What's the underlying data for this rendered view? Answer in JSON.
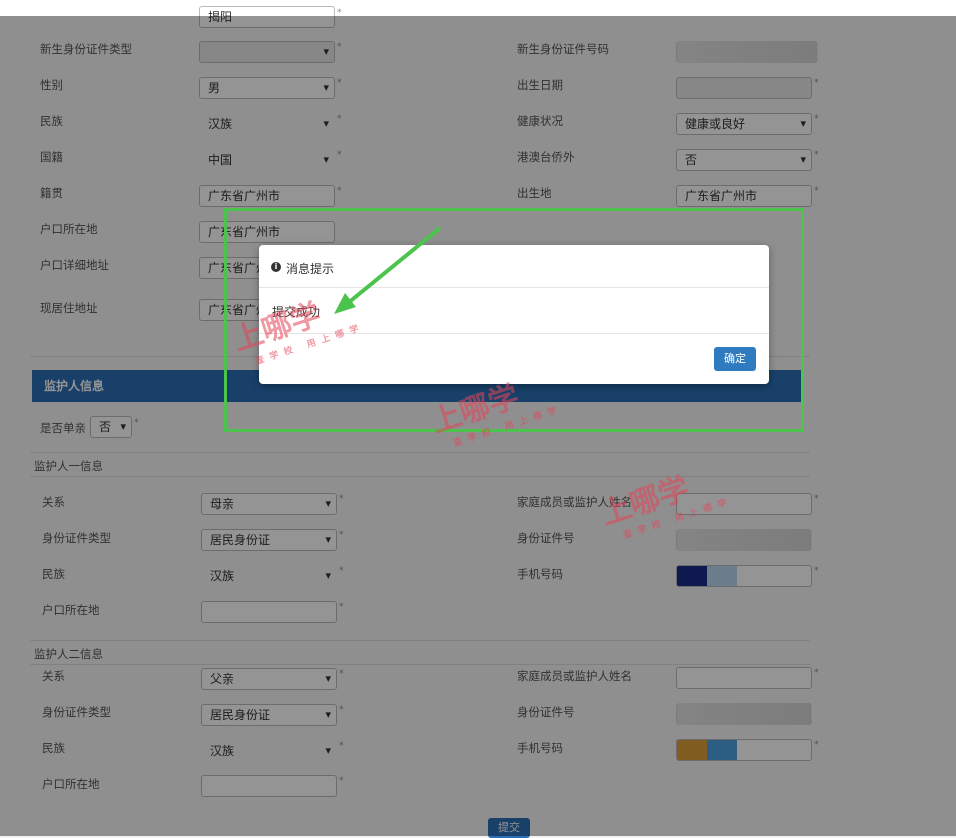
{
  "form_top": {
    "rows": [
      {
        "left_label": "",
        "left_value": "揭阳",
        "right_label": "",
        "right_value": ""
      },
      {
        "left_label": "新生身份证件类型",
        "left_value": "",
        "right_label": "新生身份证件号码",
        "right_value": ""
      },
      {
        "left_label": "性别",
        "left_value": "男",
        "right_label": "出生日期",
        "right_value": ""
      },
      {
        "left_label": "民族",
        "left_value": "汉族",
        "right_label": "健康状况",
        "right_value": "健康或良好"
      },
      {
        "left_label": "国籍",
        "left_value": "中国",
        "right_label": "港澳台侨外",
        "right_value": "否"
      },
      {
        "left_label": "籍贯",
        "left_value": "广东省广州市",
        "right_label": "出生地",
        "right_value": "广东省广州市"
      },
      {
        "left_label": "户口所在地",
        "left_value": "广东省广州市",
        "right_label": "",
        "right_value": ""
      },
      {
        "left_label": "户口详细地址",
        "left_value": "广东省广州市",
        "right_label": "",
        "right_value": ""
      },
      {
        "left_label": "现居住地址",
        "left_value": "广东省广州市",
        "right_label": "",
        "right_value": ""
      }
    ]
  },
  "guardian_section": {
    "title": "监护人信息",
    "single_parent_label": "是否单亲",
    "single_parent_value": "否",
    "guardian1_title": "监护人一信息",
    "guardian2_title": "监护人二信息",
    "guardian1": {
      "relation_label": "关系",
      "relation_value": "母亲",
      "id_type_label": "身份证件类型",
      "id_type_value": "居民身份证",
      "ethnic_label": "民族",
      "ethnic_value": "汉族",
      "hukou_label": "户口所在地",
      "name_label": "家庭成员或监护人姓名",
      "id_no_label": "身份证件号",
      "phone_label": "手机号码"
    },
    "guardian2": {
      "relation_label": "关系",
      "relation_value": "父亲",
      "id_type_label": "身份证件类型",
      "id_type_value": "居民身份证",
      "ethnic_label": "民族",
      "ethnic_value": "汉族",
      "hukou_label": "户口所在地",
      "name_label": "家庭成员或监护人姓名",
      "id_no_label": "身份证件号",
      "phone_label": "手机号码"
    }
  },
  "submit_label": "提交",
  "modal": {
    "title": "消息提示",
    "message": "提交成功",
    "confirm_label": "确定"
  },
  "watermark": {
    "brand": "上哪学",
    "tagline": "查学校 用上哪学"
  },
  "colors": {
    "section_bar": "#2a6fb6",
    "highlight_border": "#4cc34c",
    "arrow": "#4cc34c",
    "watermark": "#e1465a"
  }
}
